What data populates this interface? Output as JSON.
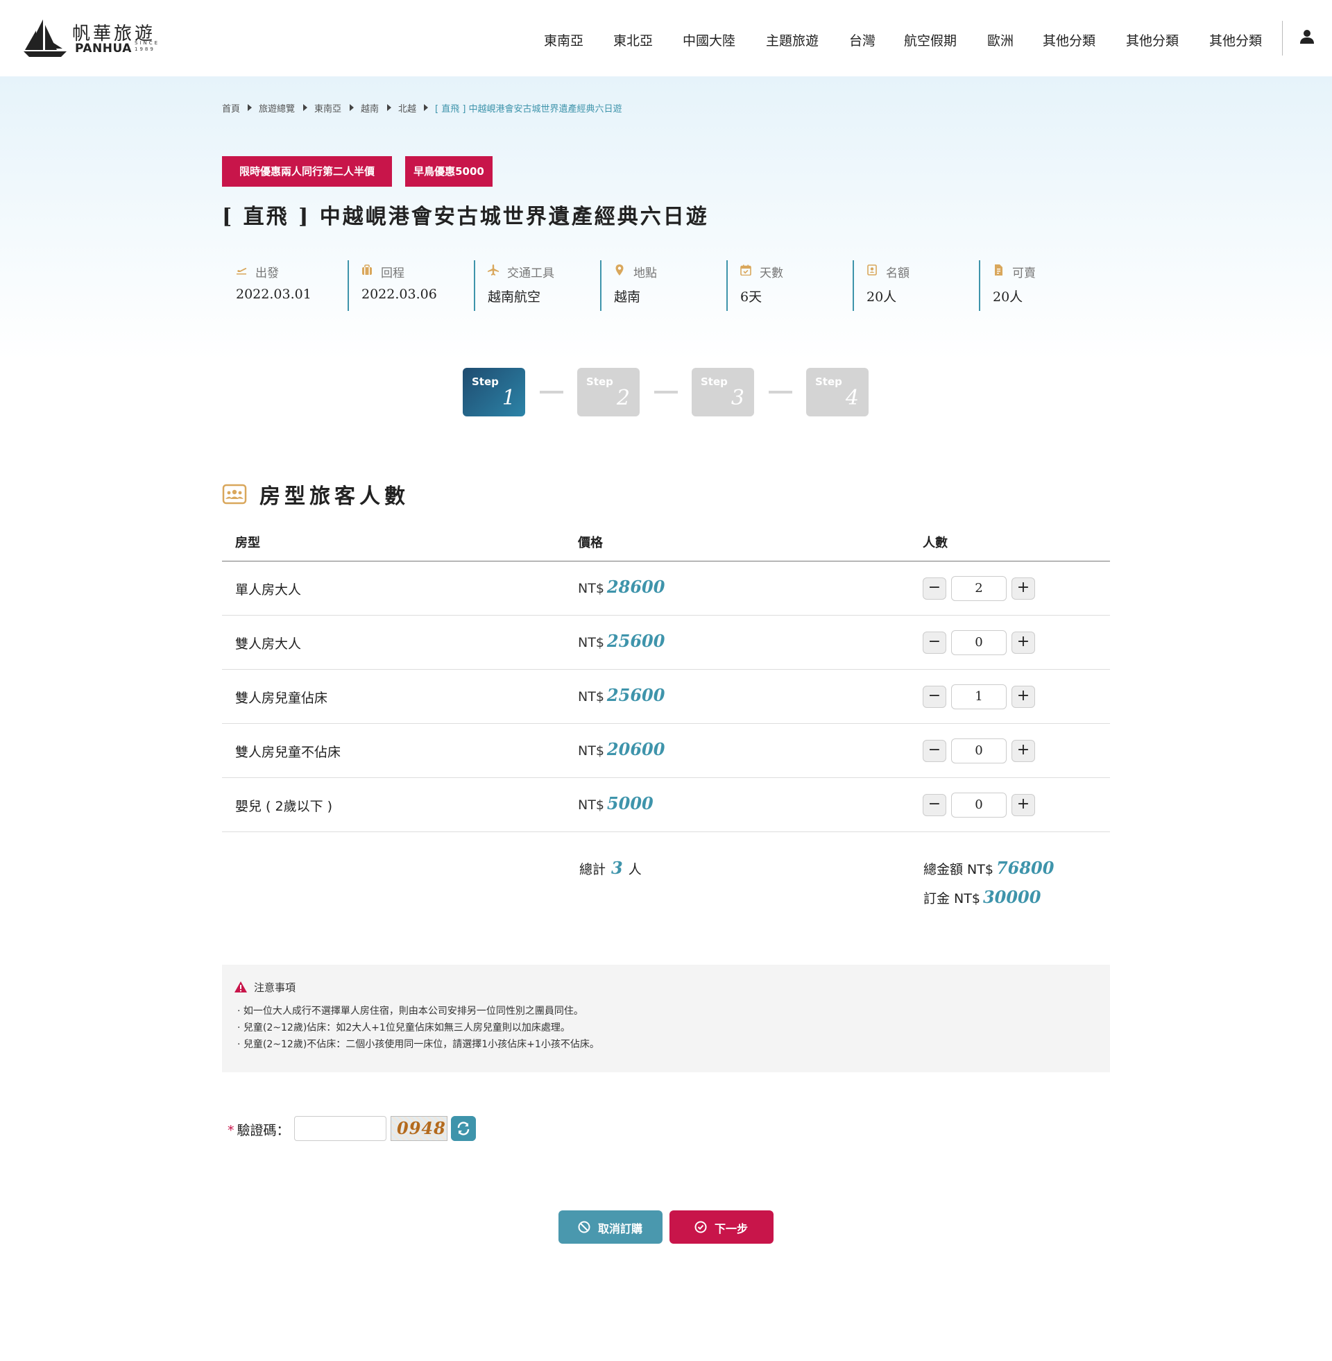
{
  "brand": {
    "name_cn": "帆華旅遊",
    "name_en": "PANHUA",
    "since": "SINCE 1989"
  },
  "nav": {
    "items": [
      "東南亞",
      "東北亞",
      "中國大陸",
      "主題旅遊",
      "台灣",
      "航空假期",
      "歐洲",
      "其他分類",
      "其他分類",
      "其他分類"
    ]
  },
  "breadcrumb": [
    "首頁",
    "旅遊總覽",
    "東南亞",
    "越南",
    "北越",
    "[ 直飛 ] 中越峴港會安古城世界遺產經典六日遊"
  ],
  "tags": [
    "限時優惠兩人同行第二人半價",
    "早鳥優惠5000"
  ],
  "tour": {
    "title": "[ 直飛 ] 中越峴港會安古城世界遺產經典六日遊",
    "info": [
      {
        "label": "出發",
        "value": "2022.03.01",
        "icon": "takeoff-icon"
      },
      {
        "label": "回程",
        "value": "2022.03.06",
        "icon": "luggage-icon"
      },
      {
        "label": "交通工具",
        "value": "越南航空",
        "icon": "airplane-icon"
      },
      {
        "label": "地點",
        "value": "越南",
        "icon": "map-pin-icon"
      },
      {
        "label": "天數",
        "value": "6天",
        "icon": "calendar-icon"
      },
      {
        "label": "名額",
        "value": "20人",
        "icon": "contact-icon"
      },
      {
        "label": "可賣",
        "value": "20人",
        "icon": "document-icon"
      }
    ]
  },
  "steps": [
    {
      "label": "Step",
      "num": "1",
      "active": true
    },
    {
      "label": "Step",
      "num": "2",
      "active": false
    },
    {
      "label": "Step",
      "num": "3",
      "active": false
    },
    {
      "label": "Step",
      "num": "4",
      "active": false
    }
  ],
  "section": {
    "title": "房型旅客人數"
  },
  "table": {
    "headers": [
      "房型",
      "價格",
      "人數"
    ],
    "currency": "NT$",
    "rows": [
      {
        "name": "單人房大人",
        "price": "28600",
        "count": "2"
      },
      {
        "name": "雙人房大人",
        "price": "25600",
        "count": "0"
      },
      {
        "name": "雙人房兒童佔床",
        "price": "25600",
        "count": "1"
      },
      {
        "name": "雙人房兒童不佔床",
        "price": "20600",
        "count": "0"
      },
      {
        "name": "嬰兒 ( 2歲以下 )",
        "price": "5000",
        "count": "0"
      }
    ],
    "minus_label": "−",
    "plus_label": "+"
  },
  "totals": {
    "count_prefix": "總計",
    "count": "3",
    "count_suffix": "人",
    "amount_label": "總金額 NT$",
    "amount": "76800",
    "deposit_label": "訂金 NT$",
    "deposit": "30000"
  },
  "notice": {
    "title": "注意事項",
    "lines": [
      "· 如一位大人成行不選擇單人房住宿，則由本公司安排另一位同性別之團員同住。",
      "· 兒童(2~12歲)佔床：如2大人+1位兒童佔床如無三人房兒童則以加床處理。",
      "· 兒童(2~12歲)不佔床：二個小孩使用同一床位，請選擇1小孩佔床+1小孩不佔床。"
    ]
  },
  "captcha": {
    "required_mark": "*",
    "label": "驗證碼：",
    "image_text": "0948",
    "value": ""
  },
  "buttons": {
    "cancel": "取消訂購",
    "next": "下一步"
  },
  "colors": {
    "accent": "#3e94ab",
    "brand_red": "#c8154a",
    "step_active": "#1f4c70",
    "info_icon": "#d9a75c"
  }
}
